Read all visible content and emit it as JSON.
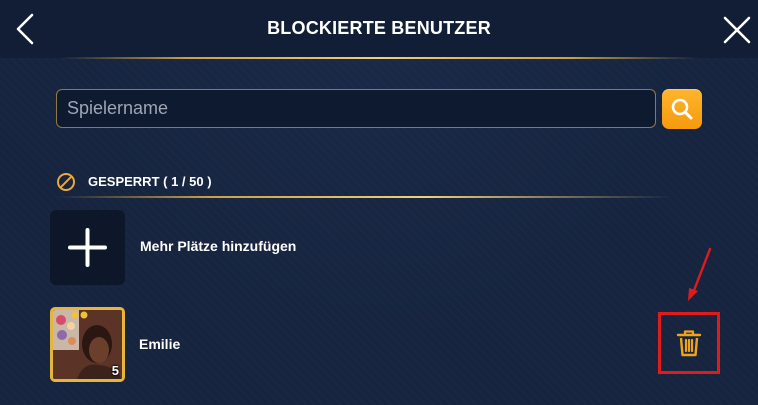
{
  "header": {
    "title": "BLOCKIERTE BENUTZER",
    "back_icon": "chevron-left-icon",
    "close_icon": "close-icon"
  },
  "search": {
    "placeholder": "Spielername",
    "value": "",
    "button_icon": "search-icon"
  },
  "blocked_section": {
    "icon": "blocked-icon",
    "label": "GESPERRT ( 1 / 50 )"
  },
  "add_slot": {
    "icon": "plus-icon",
    "label": "Mehr Plätze hinzufügen"
  },
  "blocked_users": [
    {
      "name": "Emilie",
      "level": "5",
      "delete_icon": "trash-icon"
    }
  ],
  "colors": {
    "background": "#16243f",
    "header": "#121e35",
    "gold_accent": "#c9a045",
    "search_button": "#f5a00f",
    "trash_icon": "#f0a21c",
    "highlight": "#e01b1b"
  }
}
